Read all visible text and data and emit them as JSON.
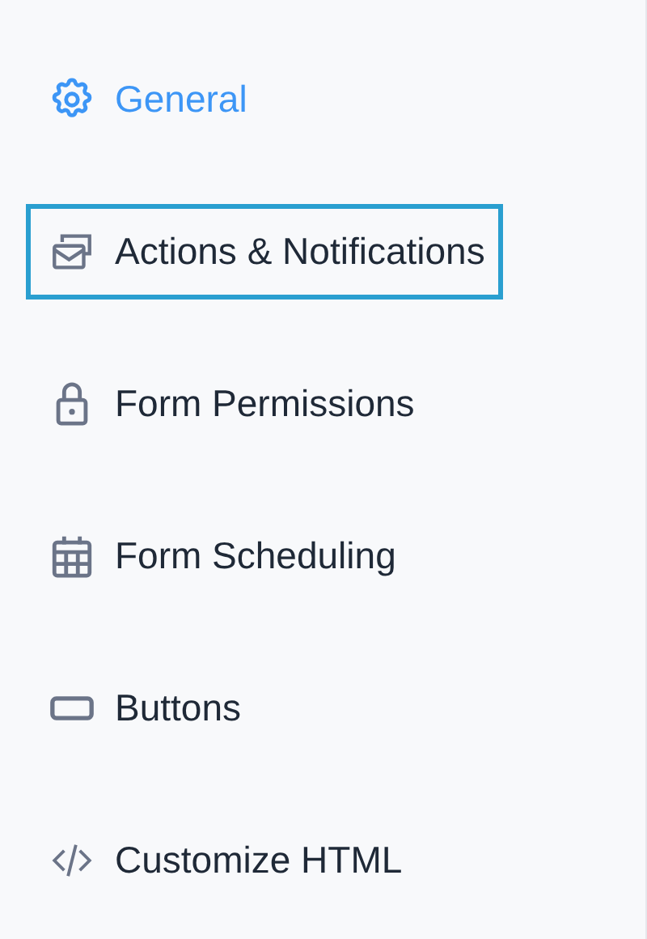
{
  "sidebar": {
    "items": [
      {
        "label": "General",
        "selected": true,
        "focused": false
      },
      {
        "label": "Actions & Notifications",
        "selected": false,
        "focused": true
      },
      {
        "label": "Form Permissions",
        "selected": false,
        "focused": false
      },
      {
        "label": "Form Scheduling",
        "selected": false,
        "focused": false
      },
      {
        "label": "Buttons",
        "selected": false,
        "focused": false
      },
      {
        "label": "Customize HTML",
        "selected": false,
        "focused": false
      }
    ]
  }
}
